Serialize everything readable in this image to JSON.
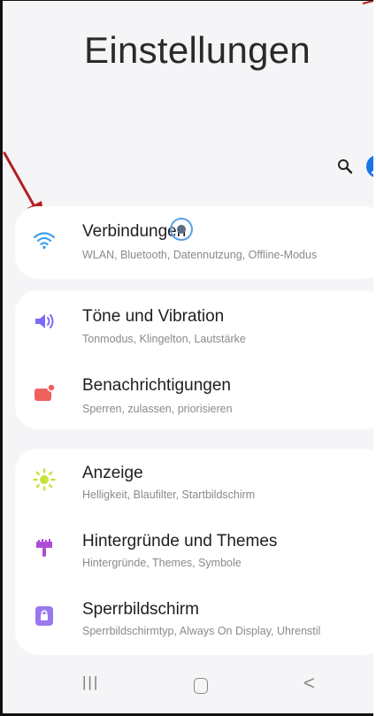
{
  "header": {
    "title": "Einstellungen"
  },
  "icons": {
    "search": "search-icon",
    "account": "account-icon"
  },
  "colors": {
    "accent": "#1a73e8",
    "arrow": "#b51f1f",
    "wifi": "#3aa0f5",
    "sound": "#7b6cf5",
    "notifications": "#f0605f",
    "display": "#c7e23a",
    "themes": "#b04bd8",
    "lockscreen": "#9a78f0"
  },
  "sections": [
    {
      "items": [
        {
          "icon": "wifi-icon",
          "title": "Verbindungen",
          "subtitle": "WLAN, Bluetooth, Datennutzung, Offline-Modus"
        }
      ]
    },
    {
      "items": [
        {
          "icon": "sound-icon",
          "title": "Töne und Vibration",
          "subtitle": "Tonmodus, Klingelton, Lautstärke"
        },
        {
          "icon": "notification-icon",
          "title": "Benachrichtigungen",
          "subtitle": "Sperren, zulassen, priorisieren"
        }
      ]
    },
    {
      "items": [
        {
          "icon": "brightness-icon",
          "title": "Anzeige",
          "subtitle": "Helligkeit, Blaufilter, Startbildschirm"
        },
        {
          "icon": "brush-icon",
          "title": "Hintergründe und Themes",
          "subtitle": "Hintergründe, Themes, Symbole"
        },
        {
          "icon": "lock-screen-icon",
          "title": "Sperrbildschirm",
          "subtitle": "Sperrbildschirmtyp, Always On Display, Uhrenstil"
        }
      ]
    }
  ],
  "navbar": {
    "recents": "|||",
    "back": "<"
  }
}
